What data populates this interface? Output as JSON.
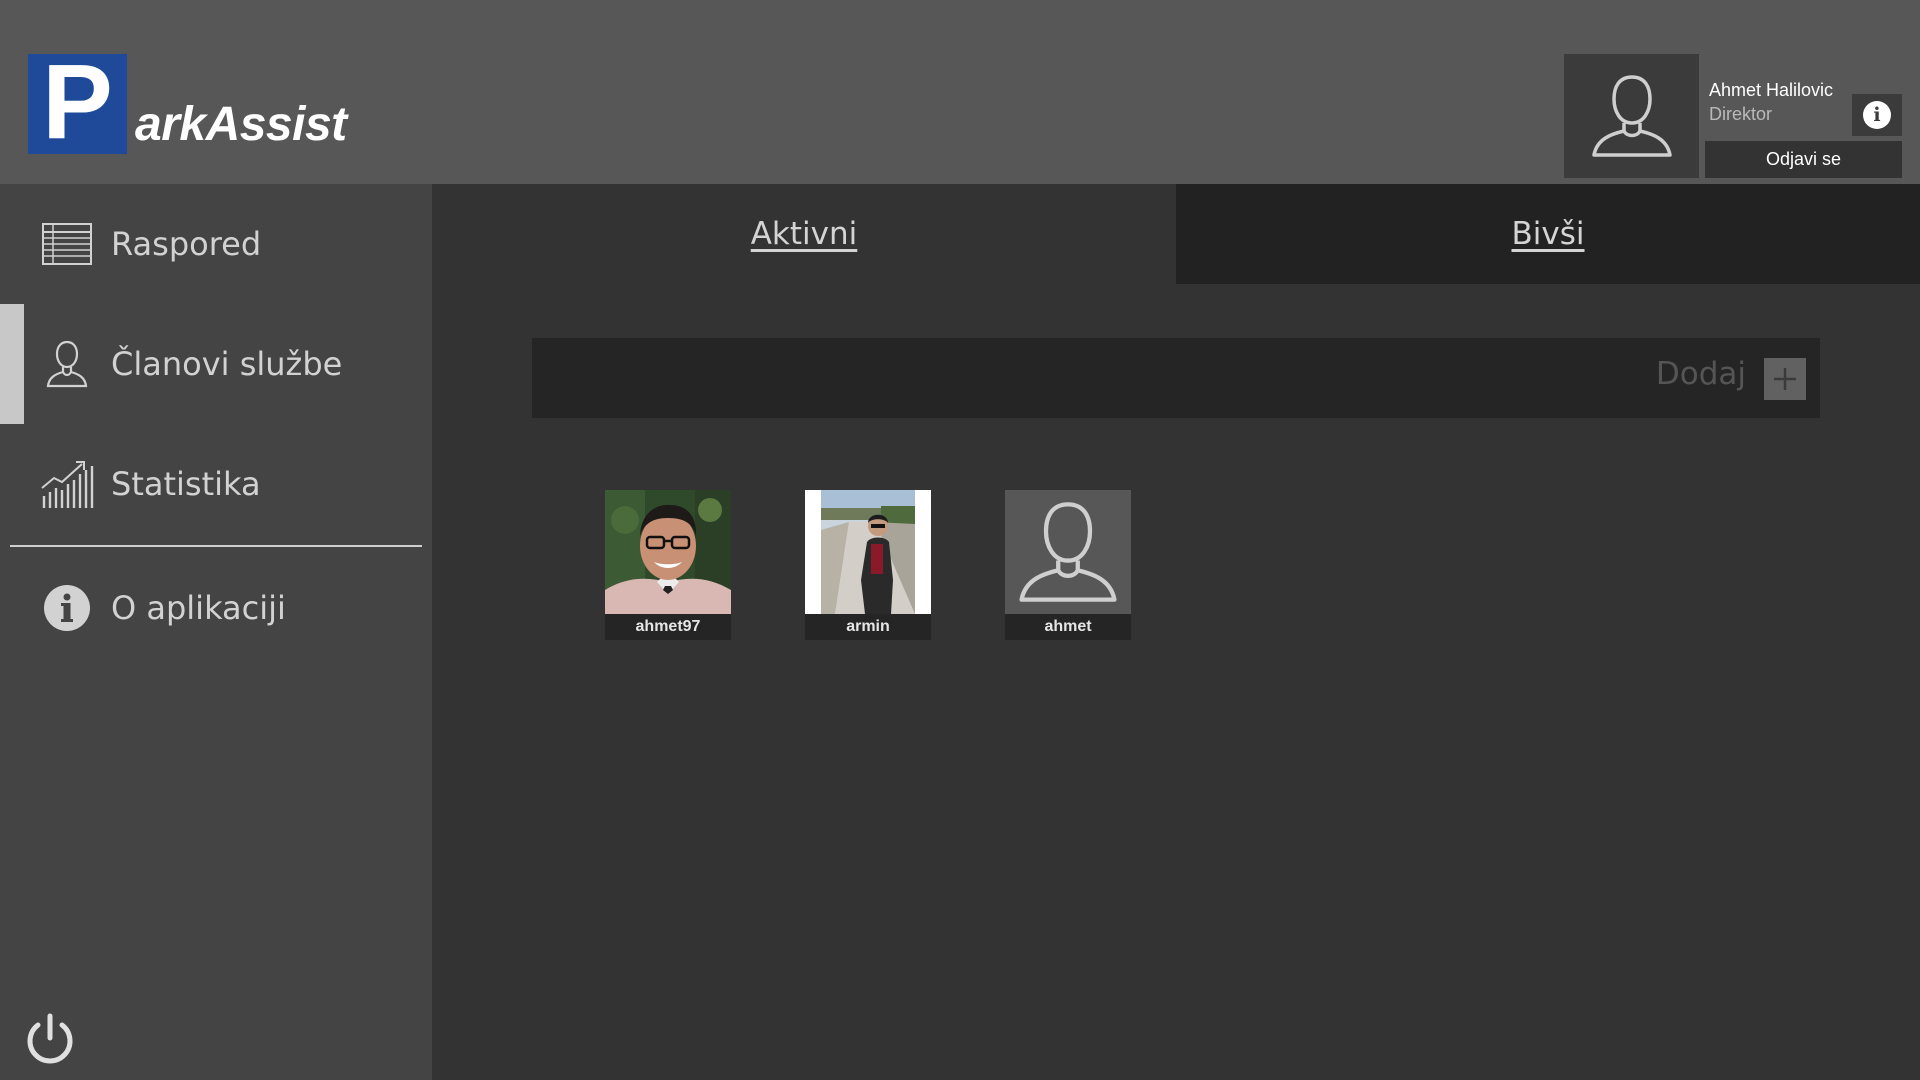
{
  "app": {
    "logo_letter": "P",
    "logo_text": "arkAssist"
  },
  "user": {
    "name": "Ahmet Halilovic",
    "role": "Direktor",
    "info_icon": "i",
    "logout_label": "Odjavi se"
  },
  "sidebar": {
    "items": [
      {
        "label": "Raspored",
        "icon": "table-icon",
        "active": false
      },
      {
        "label": "Članovi službe",
        "icon": "person-icon",
        "active": true
      },
      {
        "label": "Statistika",
        "icon": "chart-icon",
        "active": false
      },
      {
        "label": "O aplikaciji",
        "icon": "info-icon",
        "active": false
      }
    ],
    "power_icon": "power-icon"
  },
  "tabs": [
    {
      "label": "Aktivni",
      "active": true
    },
    {
      "label": "Bivši",
      "active": false
    }
  ],
  "add_bar": {
    "label": "Dodaj",
    "icon": "plus-icon"
  },
  "members": [
    {
      "username": "ahmet97",
      "photo": "portrait-photo"
    },
    {
      "username": "armin",
      "photo": "outdoor-photo"
    },
    {
      "username": "ahmet",
      "photo": "default-avatar"
    }
  ],
  "colors": {
    "header_bg": "#575757",
    "sidebar_bg": "#444444",
    "content_bg": "#333333",
    "inactive_tab_bg": "#222222",
    "logo_blue": "#1f4a9a"
  }
}
